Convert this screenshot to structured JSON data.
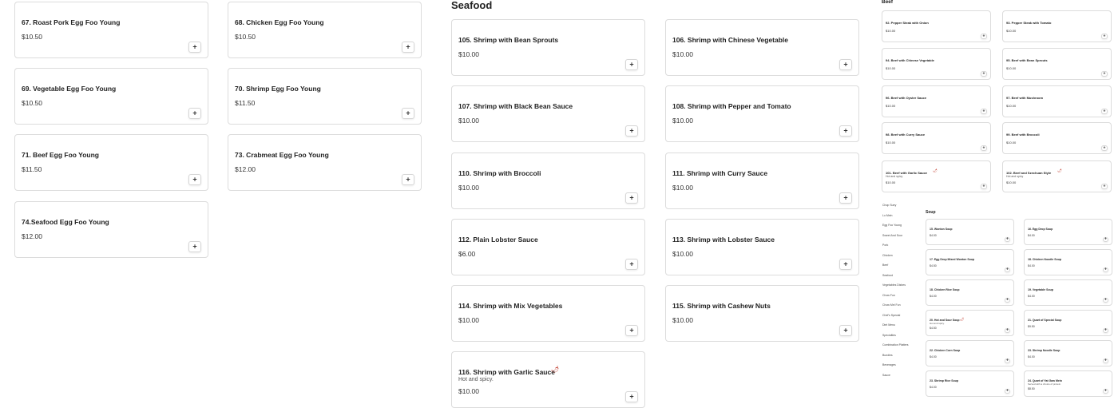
{
  "left_column": [
    {
      "name": "67. Roast Pork Egg Foo Young",
      "price": "$10.50"
    },
    {
      "name": "68. Chicken Egg Foo Young",
      "price": "$10.50"
    },
    {
      "name": "69. Vegetable Egg Foo Young",
      "price": "$10.50"
    },
    {
      "name": "70. Shrimp Egg Foo Young",
      "price": "$11.50"
    },
    {
      "name": "71. Beef Egg Foo Young",
      "price": "$11.50"
    },
    {
      "name": "73. Crabmeat Egg Foo Young",
      "price": "$12.00"
    },
    {
      "name": "74.Seafood Egg Foo Young",
      "price": "$12.00"
    }
  ],
  "seafood": {
    "title": "Seafood",
    "items": [
      {
        "name": "105. Shrimp with Bean Sprouts",
        "price": "$10.00"
      },
      {
        "name": "106. Shrimp with Chinese Vegetable",
        "price": "$10.00"
      },
      {
        "name": "107. Shrimp with Black Bean Sauce",
        "price": "$10.00"
      },
      {
        "name": "108. Shrimp with Pepper and Tomato",
        "price": "$10.00"
      },
      {
        "name": "110. Shrimp with Broccoli",
        "price": "$10.00"
      },
      {
        "name": "111. Shrimp with Curry Sauce",
        "price": "$10.00"
      },
      {
        "name": "112. Plain Lobster Sauce",
        "price": "$6.00"
      },
      {
        "name": "113. Shrimp with Lobster Sauce",
        "price": "$10.00"
      },
      {
        "name": "114. Shrimp with Mix Vegetables",
        "price": "$10.00"
      },
      {
        "name": "115. Shrimp with Cashew Nuts",
        "price": "$10.00"
      },
      {
        "name": "116. Shrimp with Garlic Sauce",
        "note": "Hot and spicy.",
        "price": "$10.00",
        "spicy": true
      }
    ]
  },
  "beef": {
    "title": "Beef",
    "items": [
      {
        "name": "92. Pepper Steak with Onion",
        "price": "$10.00"
      },
      {
        "name": "93. Pepper Steak with Tomato",
        "price": "$10.00"
      },
      {
        "name": "94. Beef with Chinese Vegetable",
        "price": "$10.00"
      },
      {
        "name": "95. Beef with Bean Sprouts",
        "price": "$10.00"
      },
      {
        "name": "96. Beef with Oyster Sauce",
        "price": "$10.00"
      },
      {
        "name": "97. Beef with Mushroom",
        "price": "$10.00"
      },
      {
        "name": "98. Beef with Curry Sauce",
        "price": "$10.00"
      },
      {
        "name": "99. Beef with Broccoli",
        "price": "$10.00"
      },
      {
        "name": "101. Beef with Garlic Sauce",
        "note": "Hot and spicy",
        "price": "$10.00",
        "spicy": true
      },
      {
        "name": "102. Beef and Szechuan Style",
        "note": "Hot and spicy",
        "price": "$10.00",
        "spicy": true
      }
    ]
  },
  "categories": [
    "Chop Suey",
    "Lo Mein",
    "Egg Foo Young",
    "Sweet And Sour",
    "Pork",
    "Chicken",
    "Beef",
    "Seafood",
    "Vegetables Dishes",
    "Chow Fun",
    "Chow Mei Fun",
    "Chef's Special",
    "Diet Menu",
    "Specialties",
    "Combination Platters",
    "Bundles",
    "Beverages",
    "Sauce"
  ],
  "soup": {
    "title": "Soup",
    "items": [
      {
        "name": "15. Wonton Soup",
        "price": "$4.00"
      },
      {
        "name": "16. Egg Drop Soup",
        "price": "$4.00"
      },
      {
        "name": "17. Egg Drop Mixed Wonton Soup",
        "price": "$4.50"
      },
      {
        "name": "18. Chicken Noodle Soup",
        "price": "$4.00"
      },
      {
        "name": "18. Chicken Rice Soup",
        "price": "$4.00"
      },
      {
        "name": "19. Vegetable Soup",
        "price": "$4.00"
      },
      {
        "name": "20. Hot and Sour Soup",
        "note": "Hot and spicy.",
        "price": "$4.50",
        "spicy": true
      },
      {
        "name": "21. Quart of Special Soup",
        "price": "$9.50"
      },
      {
        "name": "22. Chicken Corn Soup",
        "price": "$4.00"
      },
      {
        "name": "23. Shrimp Noodle Soup",
        "price": "$4.00"
      },
      {
        "name": "23. Shrimp Rice Soup",
        "price": "$4.00"
      },
      {
        "name": "24. Quart of Yat Gaw Mein",
        "note": "Served with a choice of protein.",
        "price": "$8.50"
      }
    ]
  },
  "ui": {
    "add_symbol": "+",
    "spicy_symbol": "🌶"
  }
}
